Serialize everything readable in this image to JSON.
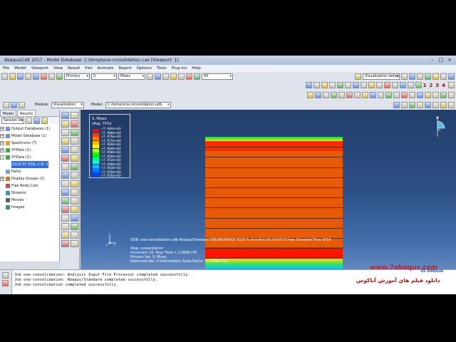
{
  "window": {
    "title": "Abaqus/CAE 2017 - Model Database: C:\\temp\\one-consolidation.cae [Viewport: 1]"
  },
  "menu": [
    "File",
    "Model",
    "Viewport",
    "View",
    "Result",
    "Plot",
    "Animate",
    "Report",
    "Options",
    "Tools",
    "Plug-ins",
    "Help"
  ],
  "toolbar": {
    "step_select": "Primary",
    "field_select": "S",
    "component_select": "Mises",
    "render_select": "All",
    "visualization_defaults": "Visualization defaults",
    "step_numbers": [
      "1",
      "2",
      "3",
      "4"
    ]
  },
  "context": {
    "module_label": "Module:",
    "module_value": "Visualization",
    "model_label": "Model:",
    "model_value": "C:/temp/one-consolidation.odb"
  },
  "left_panel": {
    "tabs": [
      "Model",
      "Results"
    ],
    "active_tab": "Results",
    "session_label": "Session Da",
    "tree": [
      {
        "label": "Output Databases (1)",
        "expander": "+"
      },
      {
        "label": "Model Database (1)",
        "expander": "+"
      },
      {
        "label": "Spectrums (7)",
        "expander": "+"
      },
      {
        "label": "XYPlots (1)",
        "expander": "+"
      },
      {
        "label": "XYData (1)",
        "expander": "-"
      },
      {
        "label": "ULU2 PI: SOIL-1 N: 2",
        "expander": "",
        "selected": true
      },
      {
        "label": "Paths",
        "expander": ""
      },
      {
        "label": "Display Groups (1)",
        "expander": "+"
      },
      {
        "label": "Free Body Cuts",
        "expander": ""
      },
      {
        "label": "Streams",
        "expander": ""
      },
      {
        "label": "Movies",
        "expander": ""
      },
      {
        "label": "Images",
        "expander": ""
      }
    ]
  },
  "legend": {
    "title": "S, Mises",
    "subtitle": "(Avg: 75%)",
    "values": [
      "+7.984e+03",
      "+7.980e+03",
      "+7.976e+03",
      "+7.972e+03",
      "+7.968e+03",
      "+7.964e+03",
      "+7.960e+03",
      "+7.956e+03",
      "+7.952e+03",
      "+7.948e+03",
      "+7.943e+03",
      "+7.939e+03",
      "+7.935e+03"
    ],
    "colors": [
      "#ff0000",
      "#ff4000",
      "#ff8000",
      "#ffbf00",
      "#ffff00",
      "#bfff00",
      "#00ff00",
      "#00ff80",
      "#00ffff",
      "#00bfff",
      "#0080ff",
      "#0040ff",
      "#0000ff"
    ]
  },
  "viewport_info": {
    "odb_line": "ODB: one-consolidation.odb     Abaqus/Standard 3DEXPERIENCE R2017x     Sun Nov 03 19:03:52 Iran Standard Time 2019",
    "step_line": "Step: consolidation",
    "increment_line": "Increment     18: Step Time =    1.000E+05",
    "primary_line": "Primary Var: S, Mises",
    "deformed_line": "Deformed Var: U   Deformation Scale Factor: +1.000e+00"
  },
  "messages": [
    "Job one-consolidation: Analysis Input File Processor completed successfully.",
    "Job one-consolidation: Abaqus/Standard completed successfully.",
    "Job one-consolidation completed successfully."
  ],
  "watermark": {
    "url": "www.7abaqus.com",
    "persian": "دانلود فیلم های آموزش آباکوس",
    "brand": "3S SIMULIA"
  },
  "colors": {
    "model_fill": "#e65a08",
    "top_band": "#ff2a00",
    "bottom_band": "#ff1400"
  }
}
